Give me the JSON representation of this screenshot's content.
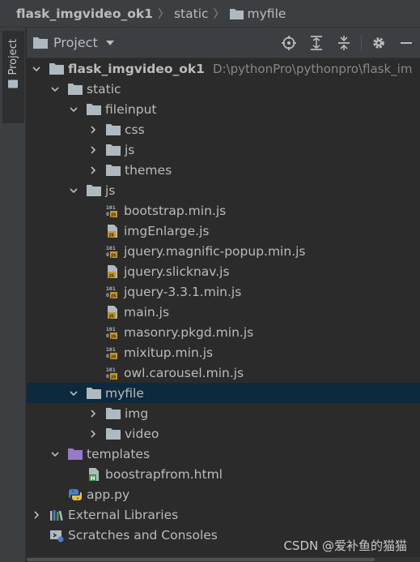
{
  "breadcrumb": {
    "items": [
      "flask_imgvideo_ok1",
      "static",
      "myfile"
    ]
  },
  "sidebar": {
    "tab_label": "Project"
  },
  "panel": {
    "title": "Project",
    "icons": [
      "locate-icon",
      "expand-all-icon",
      "collapse-all-icon",
      "gear-icon",
      "minimize-icon"
    ]
  },
  "tree": {
    "root_label": "flask_imgvideo_ok1",
    "root_path": "D:\\pythonPro\\pythonpro\\flask_im",
    "static": "static",
    "fileinput": "fileinput",
    "css": "css",
    "js_sub": "js",
    "themes": "themes",
    "js": "js",
    "files_js": [
      {
        "name": "bootstrap.min.js",
        "kind": "min"
      },
      {
        "name": "imgEnlarge.js",
        "kind": "js"
      },
      {
        "name": "jquery.magnific-popup.min.js",
        "kind": "min"
      },
      {
        "name": "jquery.slicknav.js",
        "kind": "js"
      },
      {
        "name": "jquery-3.3.1.min.js",
        "kind": "min"
      },
      {
        "name": "main.js",
        "kind": "js"
      },
      {
        "name": "masonry.pkgd.min.js",
        "kind": "min"
      },
      {
        "name": "mixitup.min.js",
        "kind": "min"
      },
      {
        "name": "owl.carousel.min.js",
        "kind": "min"
      }
    ],
    "myfile": "myfile",
    "img": "img",
    "video": "video",
    "templates": "templates",
    "html_file": "boostrapfrom.html",
    "app_file": "app.py",
    "external_libraries": "External Libraries",
    "scratches": "Scratches and Consoles"
  },
  "watermark": "CSDN @爱补鱼的猫猫",
  "colors": {
    "background": "#2b2b2b",
    "header": "#3c3f41",
    "selection": "#0d293e",
    "folder": "#aeb9c0",
    "templates_folder": "#9779c9",
    "js_badge": "#c8952a"
  }
}
